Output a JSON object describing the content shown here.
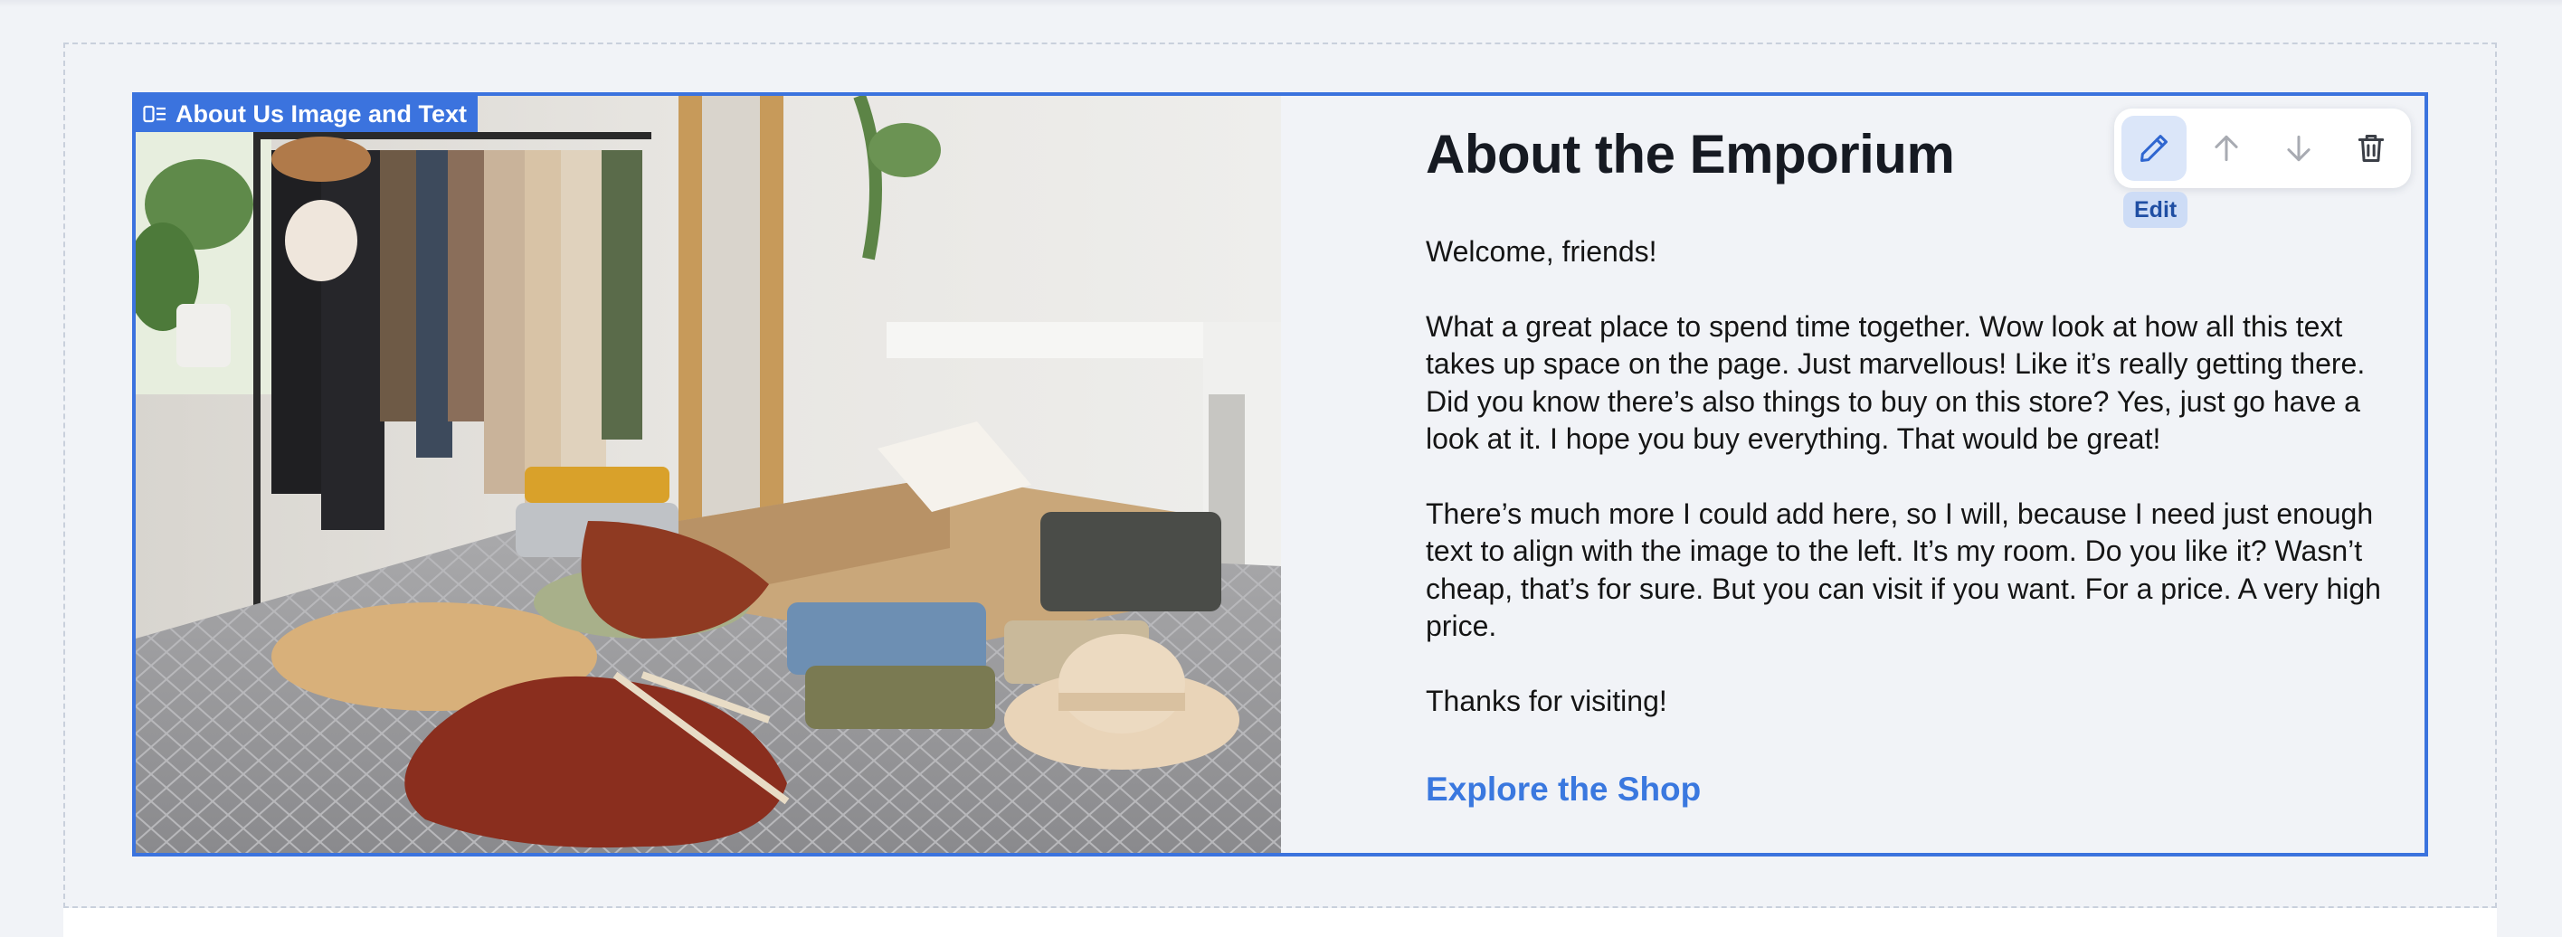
{
  "section": {
    "tag_label": "About Us Image and Text",
    "heading": "About the Emporium",
    "paragraphs": [
      "Welcome, friends!",
      "What a great place to spend time together. Wow look at how all this text takes up space on the page. Just marvellous! Like it’s really getting there. Did you know there’s also things to buy on this store? Yes, just go have a look at it. I hope you buy everything. That would be great!",
      "There’s much more I could add here, so I will, because I need just enough text to align with the image to the left. It’s my room. Do you like it? Wasn’t cheap, that’s for sure. But you can visit if you want. For a price. A very high price.",
      "Thanks for visiting!"
    ],
    "cta_label": "Explore the Shop"
  },
  "toolbar": {
    "tooltip": "Edit",
    "buttons": [
      {
        "icon": "pencil-icon",
        "label": "Edit",
        "active": true
      },
      {
        "icon": "arrow-up-icon",
        "label": "Move up",
        "active": false
      },
      {
        "icon": "arrow-down-icon",
        "label": "Move down",
        "active": false
      },
      {
        "icon": "trash-icon",
        "label": "Delete",
        "active": false
      }
    ]
  },
  "colors": {
    "accent": "#3b73de",
    "link": "#3a78df",
    "background": "#f1f3f7",
    "tooltip_bg": "#cddcf6"
  }
}
